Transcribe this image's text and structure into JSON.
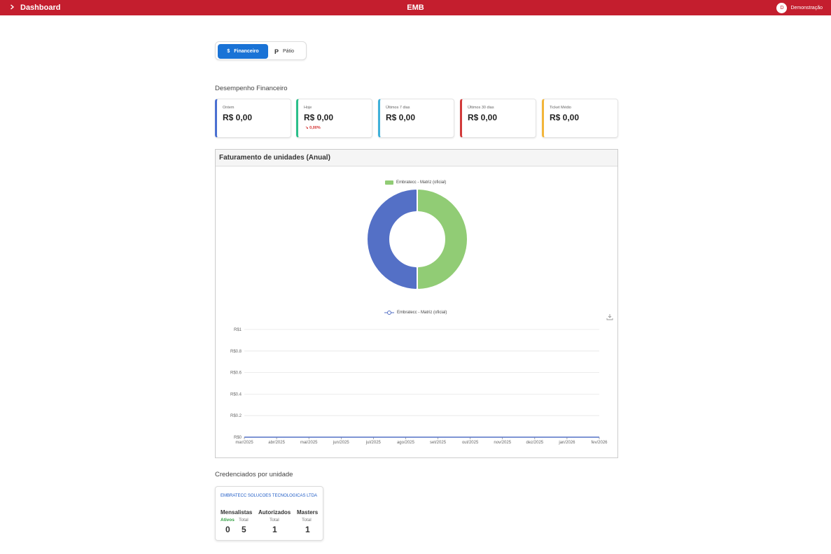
{
  "topbar": {
    "left_label": "Dashboard",
    "center_title": "EMB",
    "user_initial": "D",
    "user_name": "Demonstração",
    "color": "#c41e2e"
  },
  "toggle": {
    "financeiro_icon": "$",
    "financeiro_label": "Financeiro",
    "patio_icon": "P",
    "patio_label": "Pátio"
  },
  "desempenho": {
    "title": "Desempenho Financeiro",
    "cards": [
      {
        "label": "Ontem",
        "value": "R$ 0,00",
        "color": "#4a6fd1"
      },
      {
        "label": "Hoje",
        "value": "R$ 0,00",
        "delta": "↘ 0,00%",
        "color": "#2bbf8a"
      },
      {
        "label": "Últimos 7 dias",
        "value": "R$ 0,00",
        "color": "#3fb0d9"
      },
      {
        "label": "Últimos 30 dias",
        "value": "R$ 0,00",
        "color": "#d23a3a"
      },
      {
        "label": "Ticket Médio",
        "value": "R$ 0,00",
        "color": "#f2b53a"
      }
    ]
  },
  "faturamento": {
    "title": "Faturamento de unidades (Anual)"
  },
  "chart_data": [
    {
      "type": "pie",
      "legend": [
        "Embratecc - Matriz (oficial)"
      ],
      "legend_position": "top-center",
      "slices": [
        {
          "name": "Embratecc - Matriz (oficial)",
          "value": 50,
          "color": "#91cc75"
        },
        {
          "name": "",
          "value": 50,
          "color": "#5470c6"
        }
      ]
    },
    {
      "type": "line",
      "legend": [
        "Embratecc - Matriz (oficial)"
      ],
      "legend_position": "top-center",
      "categories": [
        "mar/2025",
        "abr/2025",
        "mai/2025",
        "jun/2025",
        "jul/2025",
        "ago/2025",
        "set/2025",
        "out/2025",
        "nov/2025",
        "dez/2025",
        "jan/2026",
        "fev/2026"
      ],
      "series": [
        {
          "name": "Embratecc - Matriz (oficial)",
          "values": [
            0,
            0,
            0,
            0,
            0,
            0,
            0,
            0,
            0,
            0,
            0,
            0
          ],
          "color": "#5470c6"
        }
      ],
      "ylim": [
        0,
        1
      ],
      "yticks": [
        "R$0",
        "R$0.2",
        "R$0.4",
        "R$0.6",
        "R$0.8",
        "R$1"
      ],
      "grid": true
    }
  ],
  "credenciados": {
    "title": "Credenciados por unidade",
    "unit_name": "EMBRATECC SOLUCOES TECNOLOGICAS LTDA",
    "mensalistas": {
      "title": "Mensalistas",
      "ativos_label": "Ativos",
      "total_label": "Total",
      "ativos": "0",
      "total": "5"
    },
    "autorizados": {
      "title": "Autorizados",
      "total_label": "Total",
      "total": "1"
    },
    "masters": {
      "title": "Masters",
      "total_label": "Total",
      "total": "1"
    }
  }
}
